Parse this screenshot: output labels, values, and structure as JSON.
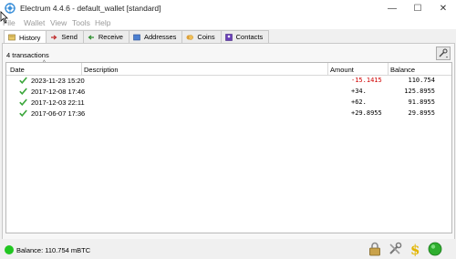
{
  "window": {
    "title": "Electrum 4.4.6  -  default_wallet  [standard]"
  },
  "menu": [
    "File",
    "Wallet",
    "View",
    "Tools",
    "Help"
  ],
  "tabs": [
    {
      "label": "History",
      "icon": "history-icon"
    },
    {
      "label": "Send",
      "icon": "send-icon"
    },
    {
      "label": "Receive",
      "icon": "receive-icon"
    },
    {
      "label": "Addresses",
      "icon": "addresses-icon"
    },
    {
      "label": "Coins",
      "icon": "coins-icon"
    },
    {
      "label": "Contacts",
      "icon": "contacts-icon"
    }
  ],
  "history": {
    "count_label": "4 transactions",
    "columns": {
      "date": "Date",
      "description": "Description",
      "amount": "Amount",
      "balance": "Balance"
    },
    "rows": [
      {
        "date": "2023-11-23 15:20",
        "description": "",
        "amount": "-15.1415",
        "balance": "110.754",
        "negative": true
      },
      {
        "date": "2017-12-08 17:46",
        "description": "",
        "amount": "+34.",
        "balance": "125.8955",
        "negative": false
      },
      {
        "date": "2017-12-03 22:11",
        "description": "",
        "amount": "+62.",
        "balance": "91.8955",
        "negative": false
      },
      {
        "date": "2017-06-07 17:36",
        "description": "",
        "amount": "+29.8955",
        "balance": "29.8955",
        "negative": false
      }
    ]
  },
  "status": {
    "balance_text": "Balance: 110.754 mBTC",
    "network_color": "#21c621"
  },
  "colors": {
    "negative": "#d00000",
    "confirmed_check": "#3aa63a"
  }
}
